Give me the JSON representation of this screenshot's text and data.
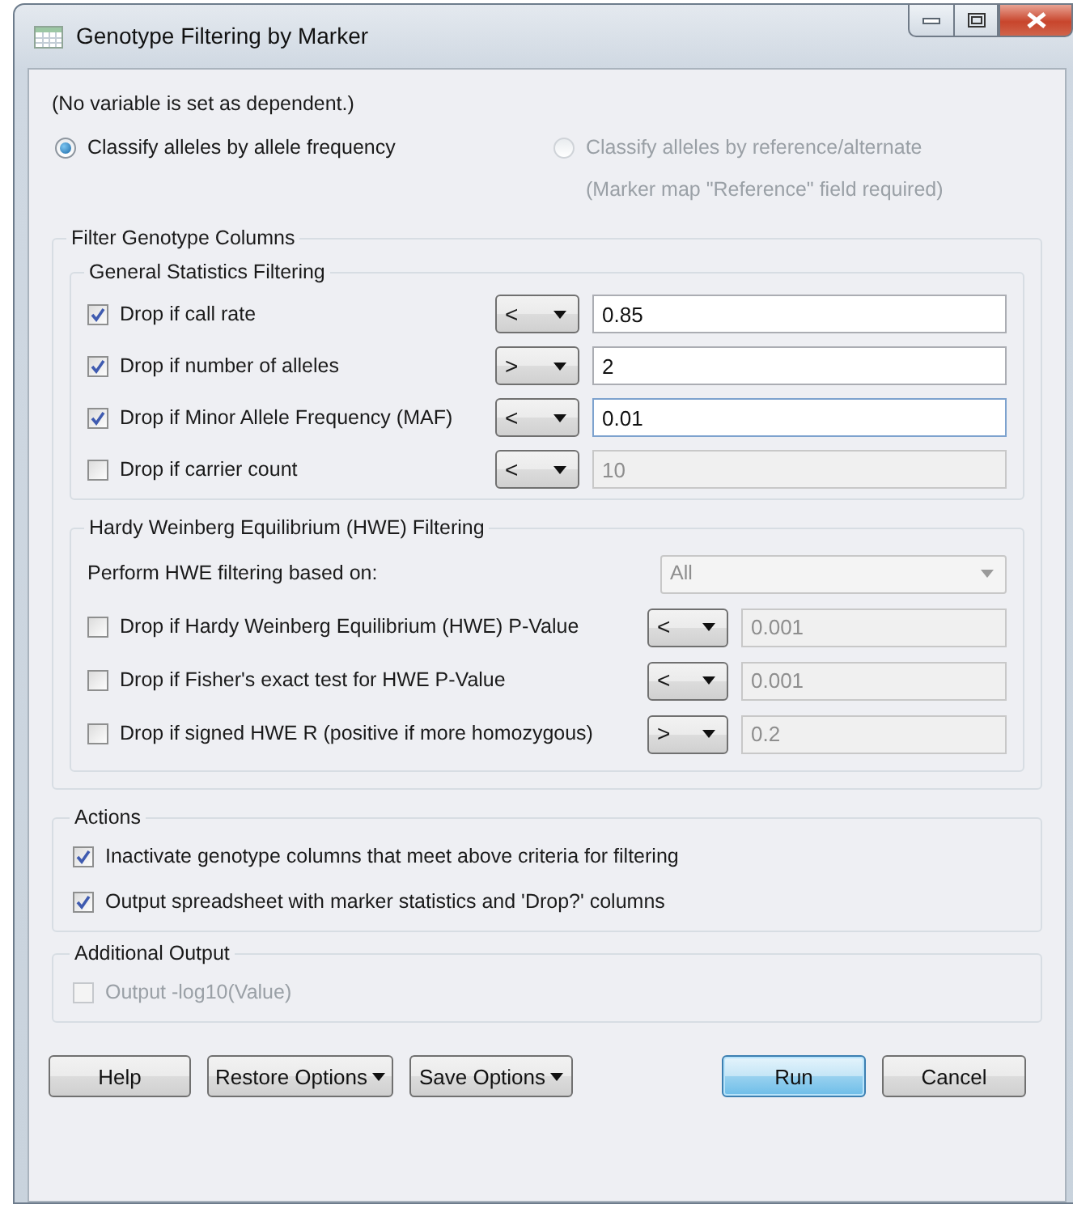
{
  "window": {
    "title": "Genotype Filtering by Marker"
  },
  "dependent_note": "(No variable is set as dependent.)",
  "classify_options": [
    {
      "label": "Classify alleles by allele frequency",
      "selected": true,
      "disabled": false
    },
    {
      "label": "Classify alleles by reference/alternate",
      "selected": false,
      "disabled": true
    }
  ],
  "classify_note": "(Marker map \"Reference\" field required)",
  "filter_group": {
    "title": "Filter Genotype Columns",
    "general": {
      "title": "General Statistics Filtering",
      "rows": [
        {
          "label": "Drop if call rate",
          "checked": true,
          "operator": "<",
          "value": "0.85"
        },
        {
          "label": "Drop if number of alleles",
          "checked": true,
          "operator": ">",
          "value": "2"
        },
        {
          "label": "Drop if Minor Allele Frequency (MAF)",
          "checked": true,
          "operator": "<",
          "value": "0.01"
        },
        {
          "label": "Drop if carrier count",
          "checked": false,
          "operator": "<",
          "value": "10"
        }
      ]
    },
    "hwe": {
      "title": "Hardy Weinberg Equilibrium (HWE) Filtering",
      "basis_label": "Perform HWE filtering based on:",
      "basis_value": "All",
      "basis_disabled": true,
      "rows": [
        {
          "label": "Drop if Hardy Weinberg Equilibrium (HWE) P-Value",
          "checked": false,
          "operator": "<",
          "value": "0.001"
        },
        {
          "label": "Drop if Fisher's exact test for HWE P-Value",
          "checked": false,
          "operator": "<",
          "value": "0.001"
        },
        {
          "label": "Drop if signed HWE R (positive if more homozygous)",
          "checked": false,
          "operator": ">",
          "value": "0.2"
        }
      ]
    }
  },
  "actions": {
    "title": "Actions",
    "items": [
      {
        "label": "Inactivate genotype columns that meet above criteria for filtering",
        "checked": true,
        "disabled": false
      },
      {
        "label": "Output spreadsheet with marker statistics and 'Drop?' columns",
        "checked": true,
        "disabled": false
      }
    ]
  },
  "additional_output": {
    "title": "Additional Output",
    "items": [
      {
        "label": "Output -log10(Value)",
        "checked": false,
        "disabled": true
      }
    ]
  },
  "buttons": [
    {
      "label": "Help",
      "kind": "plain",
      "default": false
    },
    {
      "label": "Restore Options",
      "kind": "menu",
      "default": false
    },
    {
      "label": "Save Options",
      "kind": "menu",
      "default": false
    },
    {
      "label": "Run",
      "kind": "plain",
      "default": true
    },
    {
      "label": "Cancel",
      "kind": "plain",
      "default": false
    }
  ]
}
